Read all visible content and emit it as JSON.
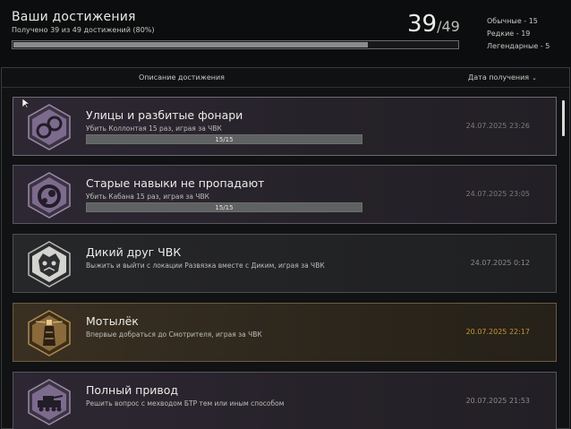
{
  "header": {
    "title": "Ваши достижения",
    "subtitle": "Получено 39 из 49 достижений (80%)",
    "progress_fraction": 0.8,
    "count": "39",
    "total": "/49",
    "rarity": [
      "Обычные - 15",
      "Редкие - 19",
      "Легендарные - 5"
    ]
  },
  "table": {
    "col_description": "Описание достижения",
    "col_date": "Дата получения",
    "sort_icon": "chevron-down-icon"
  },
  "achievements": [
    {
      "name": "Улицы и разбитые фонари",
      "desc": "Убить Коллонтая 15 раз, играя за ЧВК",
      "progress": "15/15",
      "date": "24.07.2025 23:26",
      "rarity": "purple",
      "icon": "handcuffs-icon"
    },
    {
      "name": "Старые навыки не пропадают",
      "desc": "Убить Кабана 15 раз, играя за ЧВК",
      "progress": "15/15",
      "date": "24.07.2025 23:05",
      "rarity": "purple",
      "icon": "brass-knuckles-icon"
    },
    {
      "name": "Дикий друг ЧВК",
      "desc": "Выжить и выйти с локации Развязка вместе с Диким, играя за ЧВК",
      "progress": "",
      "date": "24.07.2025 0:12",
      "rarity": "gray",
      "icon": "wild-face-icon"
    },
    {
      "name": "Мотылёк",
      "desc": "Впервые добраться до Смотрителя, играя за ЧВК",
      "progress": "",
      "date": "20.07.2025 22:17",
      "rarity": "gold",
      "icon": "lighthouse-icon"
    },
    {
      "name": "Полный привод",
      "desc": "Решить вопрос с мехводом БТР тем или иным способом",
      "progress": "",
      "date": "20.07.2025 21:53",
      "rarity": "purple",
      "icon": "armored-vehicle-icon"
    }
  ],
  "colors": {
    "purple_badge": "#7a6a8a",
    "gray_badge": "#6f7173",
    "gold_badge": "#8a6a3a",
    "gold_date": "#c8932f"
  }
}
